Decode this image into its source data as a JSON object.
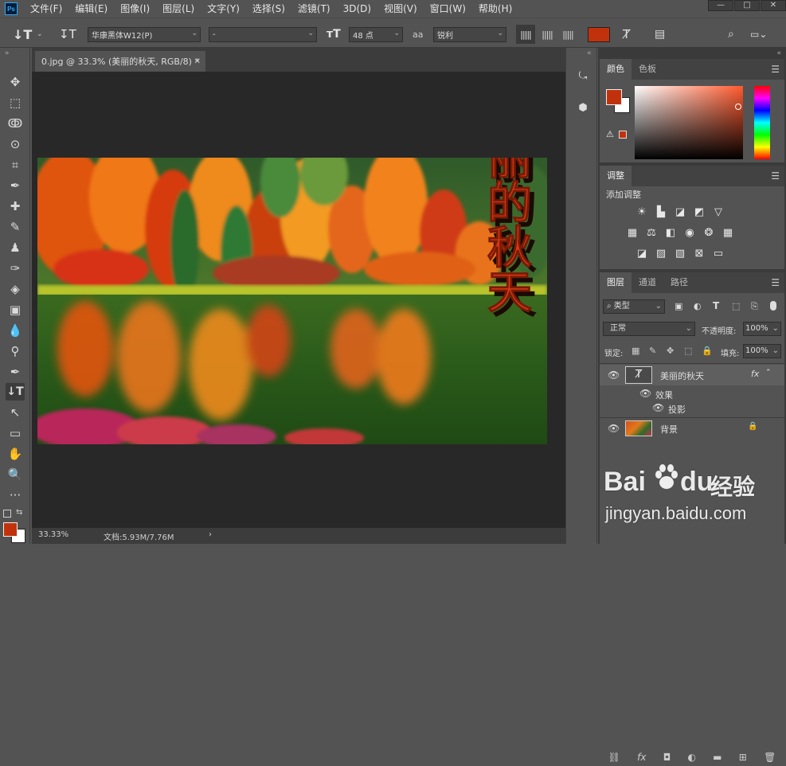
{
  "app": {
    "logo_text": "Ps"
  },
  "menu": [
    "文件(F)",
    "编辑(E)",
    "图像(I)",
    "图层(L)",
    "文字(Y)",
    "选择(S)",
    "滤镜(T)",
    "3D(D)",
    "视图(V)",
    "窗口(W)",
    "帮助(H)"
  ],
  "window_controls": {
    "minimize": "—",
    "maximize": "□",
    "close": "✕"
  },
  "options": {
    "font_family": "华康黑体W12(P)",
    "font_style": "-",
    "font_size": "48 点",
    "anti_alias_icon": "aa",
    "anti_alias": "锐利",
    "text_color": "#c1320c"
  },
  "document": {
    "tab_title": "0.jpg @ 33.3% (美丽的秋天, RGB/8) *",
    "tab_close": "✕",
    "canvas_text": "美丽的秋天",
    "zoom": "33.33%",
    "doc_info": "文档:5.93M/7.76M"
  },
  "color_panel": {
    "tabs": [
      "颜色",
      "色板"
    ],
    "fg_color": "#c1320c",
    "bg_color": "#ffffff"
  },
  "adjust_panel": {
    "tab": "调整",
    "add_label": "添加调整"
  },
  "layers_panel": {
    "tabs": [
      "图层",
      "通道",
      "路径"
    ],
    "filter_kind": "类型",
    "blend_mode": "正常",
    "opacity_label": "不透明度:",
    "opacity_value": "100%",
    "lock_label": "锁定:",
    "fill_label": "填充:",
    "fill_value": "100%",
    "layers": [
      {
        "name": "美丽的秋天",
        "fx": "fx",
        "effects_label": "效果",
        "effect": "投影"
      },
      {
        "name": "背景"
      }
    ]
  },
  "watermark": {
    "brand": "Bai",
    "brand2": "du",
    "cn": "经验",
    "url": "jingyan.baidu.com"
  }
}
